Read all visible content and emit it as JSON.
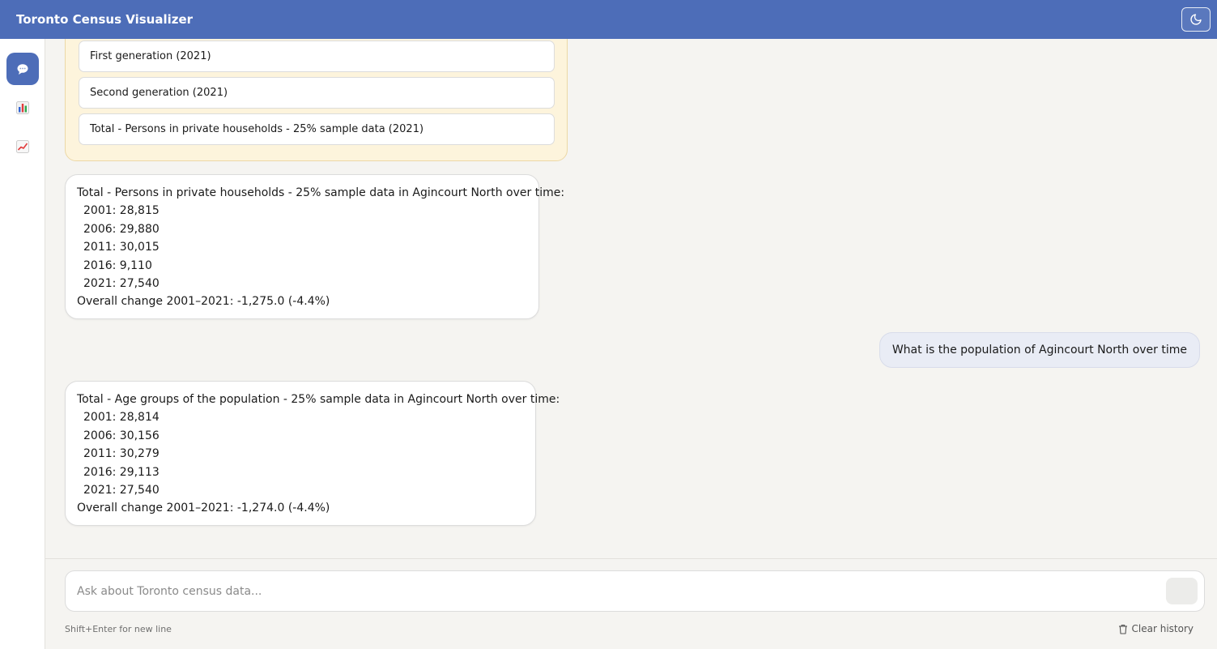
{
  "header": {
    "title": "Toronto Census Visualizer",
    "theme_toggle_icon": "moon-icon"
  },
  "sidebar": {
    "items": [
      {
        "name": "chat",
        "icon": "speech-bubble-icon",
        "active": true
      },
      {
        "name": "bar-chart",
        "icon": "bar-chart-icon",
        "active": false
      },
      {
        "name": "trend",
        "icon": "line-chart-icon",
        "active": false
      }
    ]
  },
  "options": [
    {
      "label": "First generation (2021)"
    },
    {
      "label": "Second generation (2021)"
    },
    {
      "label": "Total - Persons in private households - 25% sample data (2021)"
    }
  ],
  "messages": [
    {
      "heading": "Total - Persons in private households - 25% sample data in Agincourt North over time:",
      "rows": [
        "2001: 28,815",
        "2006: 29,880",
        "2011: 30,015",
        "2016: 9,110",
        "2021: 27,540"
      ],
      "summary": "Overall change 2001–2021: -1,275.0 (-4.4%)"
    },
    {
      "heading": "Total - Age groups of the population - 25% sample data in Agincourt North over time:",
      "rows": [
        "2001: 28,814",
        "2006: 30,156",
        "2011: 30,279",
        "2016: 29,113",
        "2021: 27,540"
      ],
      "summary": "Overall change 2001–2021: -1,274.0 (-4.4%)"
    }
  ],
  "user_message": "What is the population of Agincourt North over time",
  "composer": {
    "placeholder": "Ask about Toronto census data...",
    "value": "",
    "hint": "Shift+Enter for new line",
    "clear_label": "Clear history"
  },
  "colors": {
    "primary": "#4d6db8",
    "background": "#f5f4f1",
    "options_card": "#fdf4dc",
    "user_bubble": "#e9ecf5"
  }
}
